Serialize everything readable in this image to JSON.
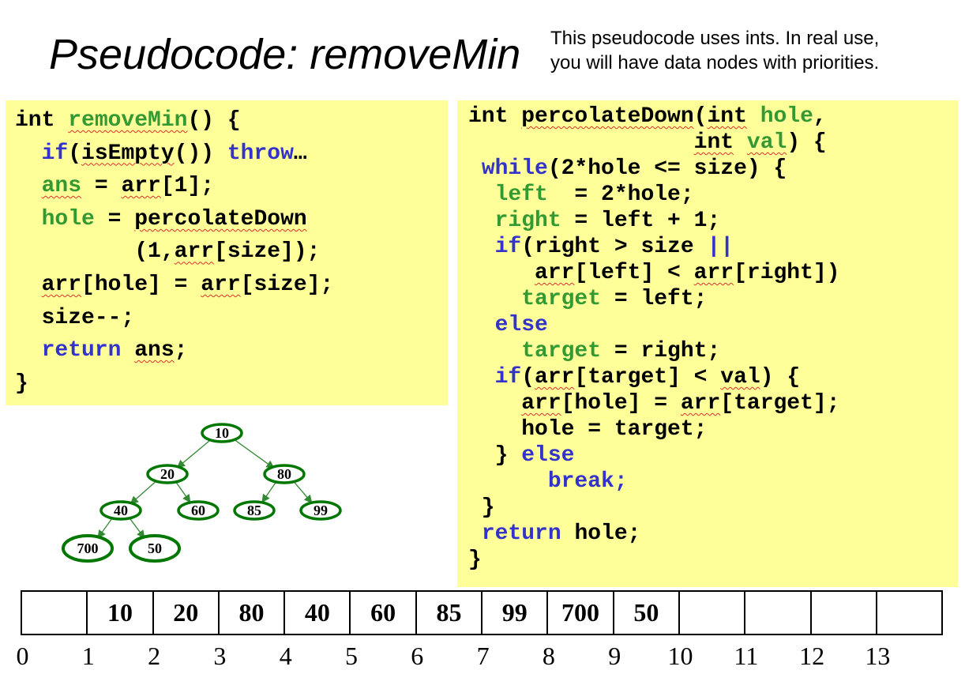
{
  "title": "Pseudocode: removeMin",
  "note": {
    "line1": "This pseudocode uses ints.  In real use,",
    "line2": "you will have data nodes with priorities."
  },
  "left_code": [
    [
      [
        "int ",
        ""
      ],
      [
        "removeMin",
        "gr wavy"
      ],
      [
        "() {",
        ""
      ]
    ],
    [
      [
        "  ",
        ""
      ],
      [
        "if",
        "kw"
      ],
      [
        "(",
        ""
      ],
      [
        "isEmpty",
        "wavy"
      ],
      [
        "()) ",
        ""
      ],
      [
        "throw",
        "kw"
      ],
      [
        "…",
        ""
      ]
    ],
    [
      [
        "  ",
        ""
      ],
      [
        "ans",
        "gr wavy"
      ],
      [
        " = ",
        ""
      ],
      [
        "arr",
        "wavy"
      ],
      [
        "[1];",
        ""
      ]
    ],
    [
      [
        "  ",
        ""
      ],
      [
        "hole",
        "gr"
      ],
      [
        " = ",
        ""
      ],
      [
        "percolateDown",
        "wavy"
      ]
    ],
    [
      [
        "         (1,",
        ""
      ],
      [
        "arr",
        "wavy"
      ],
      [
        "[size]);",
        ""
      ]
    ],
    [
      [
        "  ",
        ""
      ],
      [
        "arr",
        "wavy"
      ],
      [
        "[hole] = ",
        ""
      ],
      [
        "arr",
        "wavy"
      ],
      [
        "[size];",
        ""
      ]
    ],
    [
      [
        "  size--;",
        ""
      ]
    ],
    [
      [
        "  ",
        ""
      ],
      [
        "return",
        "kw"
      ],
      [
        " ",
        ""
      ],
      [
        "ans",
        "wavy"
      ],
      [
        ";",
        ""
      ]
    ],
    [
      [
        "}",
        ""
      ]
    ]
  ],
  "right_code": [
    [
      [
        "int ",
        ""
      ],
      [
        "percolateDown",
        "wavy"
      ],
      [
        "(",
        ""
      ],
      [
        "int",
        "wavy"
      ],
      [
        " ",
        ""
      ],
      [
        "hole",
        "gr"
      ],
      [
        ",",
        ""
      ]
    ],
    [
      [
        "                 ",
        ""
      ],
      [
        "int",
        "wavy"
      ],
      [
        " ",
        ""
      ],
      [
        "val",
        "gr wavy"
      ],
      [
        ") {",
        ""
      ]
    ],
    [
      [
        " ",
        ""
      ],
      [
        "while",
        "kw"
      ],
      [
        "(2*hole <= size) {",
        ""
      ]
    ],
    [
      [
        "  ",
        ""
      ],
      [
        "left",
        "gr"
      ],
      [
        "  = 2*hole;",
        ""
      ]
    ],
    [
      [
        "  ",
        ""
      ],
      [
        "right",
        "gr"
      ],
      [
        " = left + 1;",
        ""
      ]
    ],
    [
      [
        "  ",
        ""
      ],
      [
        "if",
        "kw"
      ],
      [
        "(right > size ",
        ""
      ],
      [
        "||",
        "kw"
      ]
    ],
    [
      [
        "     ",
        ""
      ],
      [
        "arr",
        "wavy"
      ],
      [
        "[left] < ",
        ""
      ],
      [
        "arr",
        "wavy"
      ],
      [
        "[right])",
        ""
      ]
    ],
    [
      [
        "    ",
        ""
      ],
      [
        "target",
        "gr"
      ],
      [
        " = left;",
        ""
      ]
    ],
    [
      [
        "  ",
        ""
      ],
      [
        "else",
        "kw"
      ]
    ],
    [
      [
        "    ",
        ""
      ],
      [
        "target",
        "gr"
      ],
      [
        " = right;",
        ""
      ]
    ],
    [
      [
        "  ",
        ""
      ],
      [
        "if",
        "kw"
      ],
      [
        "(",
        ""
      ],
      [
        "arr",
        "wavy"
      ],
      [
        "[target] < ",
        ""
      ],
      [
        "val",
        "wavy"
      ],
      [
        ") {",
        ""
      ]
    ],
    [
      [
        "    ",
        ""
      ],
      [
        "arr",
        "wavy"
      ],
      [
        "[hole] = ",
        ""
      ],
      [
        "arr",
        "wavy"
      ],
      [
        "[target];",
        ""
      ]
    ],
    [
      [
        "    hole = target;",
        ""
      ]
    ],
    [
      [
        "  } ",
        ""
      ],
      [
        "else",
        "kw"
      ]
    ],
    [
      [
        "      ",
        ""
      ],
      [
        "break;",
        "kw"
      ]
    ],
    [
      [
        " }",
        ""
      ]
    ],
    [
      [
        " ",
        ""
      ],
      [
        "return",
        "kw"
      ],
      [
        " hole;",
        ""
      ]
    ],
    [
      [
        "}",
        ""
      ]
    ]
  ],
  "tree": {
    "nodes": [
      {
        "id": "n10",
        "label": "10"
      },
      {
        "id": "n20",
        "label": "20"
      },
      {
        "id": "n80",
        "label": "80"
      },
      {
        "id": "n40",
        "label": "40"
      },
      {
        "id": "n60",
        "label": "60"
      },
      {
        "id": "n85",
        "label": "85"
      },
      {
        "id": "n99",
        "label": "99"
      },
      {
        "id": "n700",
        "label": "700"
      },
      {
        "id": "n50",
        "label": "50"
      }
    ],
    "edges": [
      [
        "n10",
        "n20"
      ],
      [
        "n10",
        "n80"
      ],
      [
        "n20",
        "n40"
      ],
      [
        "n20",
        "n60"
      ],
      [
        "n80",
        "n85"
      ],
      [
        "n80",
        "n99"
      ],
      [
        "n40",
        "n700"
      ],
      [
        "n40",
        "n50"
      ]
    ],
    "node_color": "#007700",
    "edge_color": "#338833"
  },
  "array": {
    "values": [
      "",
      "10",
      "20",
      "80",
      "40",
      "60",
      "85",
      "99",
      "700",
      "50",
      "",
      "",
      "",
      ""
    ],
    "indices": [
      "0",
      "1",
      "2",
      "3",
      "4",
      "5",
      "6",
      "7",
      "8",
      "9",
      "10",
      "11",
      "12",
      "13"
    ]
  },
  "colors": {
    "keyword": "#3333cc",
    "identifier": "#339933",
    "code_background": "#ffff99",
    "spellcheck_underline": "#e03030"
  }
}
